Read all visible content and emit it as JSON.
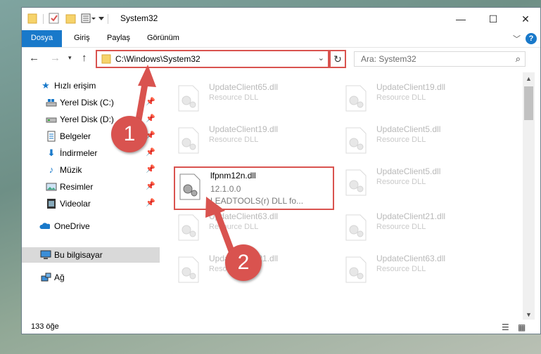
{
  "window": {
    "title": "System32",
    "controls": {
      "minimize": "—",
      "maximize": "☐",
      "close": "✕"
    }
  },
  "ribbon": {
    "tabs": [
      "Dosya",
      "Giriş",
      "Paylaş",
      "Görünüm"
    ],
    "help": "?"
  },
  "nav": {
    "address": "C:\\Windows\\System32",
    "search_placeholder": "Ara: System32"
  },
  "sidebar": {
    "items": [
      {
        "label": "Hızlı erişim",
        "icon": "star-icon",
        "pinned": false
      },
      {
        "label": "Yerel Disk (C:)",
        "icon": "drive-icon",
        "pinned": true
      },
      {
        "label": "Yerel Disk (D:)",
        "icon": "drive-icon",
        "pinned": true
      },
      {
        "label": "Belgeler",
        "icon": "document-icon",
        "pinned": true
      },
      {
        "label": "İndirmeler",
        "icon": "download-icon",
        "pinned": true
      },
      {
        "label": "Müzik",
        "icon": "music-icon",
        "pinned": true
      },
      {
        "label": "Resimler",
        "icon": "pictures-icon",
        "pinned": true
      },
      {
        "label": "Videolar",
        "icon": "video-icon",
        "pinned": true
      },
      {
        "label": "OneDrive",
        "icon": "cloud-icon",
        "pinned": false
      },
      {
        "label": "Bu bilgisayar",
        "icon": "computer-icon",
        "pinned": false,
        "selected": true
      },
      {
        "label": "Ağ",
        "icon": "network-icon",
        "pinned": false
      }
    ]
  },
  "files": {
    "items": [
      {
        "name": "UpdateClient65.dll",
        "desc": "Resource DLL",
        "faded": true
      },
      {
        "name": "UpdateClient19.dll",
        "desc": "Resource DLL",
        "faded": true
      },
      {
        "name": "UpdateClient19.dll",
        "desc": "Resource DLL",
        "faded": true
      },
      {
        "name": "UpdateClient5.dll",
        "desc": "Resource DLL",
        "faded": true
      },
      {
        "name": "lfpnm12n.dll",
        "version": "12.1.0.0",
        "desc": "LEADTOOLS(r) DLL fo...",
        "faded": false,
        "highlighted": true
      },
      {
        "name": "UpdateClient5.dll",
        "desc": "Resource DLL",
        "faded": true
      },
      {
        "name": "UpdateClient63.dll",
        "desc": "Resource DLL",
        "faded": true
      },
      {
        "name": "UpdateClient21.dll",
        "desc": "Resource DLL",
        "faded": true
      },
      {
        "name": "UpdateClient21.dll",
        "desc": "Resource DLL",
        "faded": true
      },
      {
        "name": "UpdateClient63.dll",
        "desc": "Resource DLL",
        "faded": true
      }
    ]
  },
  "status": {
    "count": "133 öğe"
  },
  "annotations": [
    {
      "label": "1",
      "color": "#d9534f"
    },
    {
      "label": "2",
      "color": "#d9534f"
    }
  ]
}
